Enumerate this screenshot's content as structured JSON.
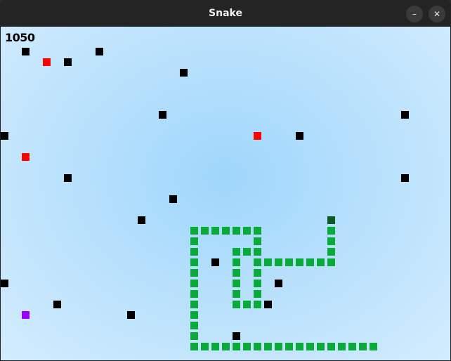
{
  "window": {
    "title": "Snake",
    "minimize_label": "–",
    "close_label": "✕"
  },
  "game": {
    "score": "1050",
    "grid_cell": 15,
    "colors": {
      "obstacle": "#000000",
      "food": "#ff0000",
      "special_food": "#9b00ff",
      "snake_body": "#0aaa3a",
      "snake_head": "#0a5a25"
    },
    "obstacles": [
      [
        2,
        2
      ],
      [
        9,
        2
      ],
      [
        6,
        3
      ],
      [
        17,
        4
      ],
      [
        15,
        8
      ],
      [
        38,
        8
      ],
      [
        0,
        10
      ],
      [
        28,
        10
      ],
      [
        6,
        14
      ],
      [
        38,
        14
      ],
      [
        16,
        16
      ],
      [
        13,
        18
      ],
      [
        20,
        22
      ],
      [
        0,
        24
      ],
      [
        26,
        24
      ],
      [
        5,
        26
      ],
      [
        25,
        26
      ],
      [
        12,
        27
      ],
      [
        22,
        29
      ]
    ],
    "food": [
      [
        4,
        3
      ],
      [
        24,
        10
      ],
      [
        2,
        12
      ]
    ],
    "special_food": [
      [
        2,
        27
      ]
    ],
    "snake_head": [
      31,
      18
    ],
    "snake_body": [
      [
        31,
        19
      ],
      [
        31,
        20
      ],
      [
        31,
        21
      ],
      [
        31,
        22
      ],
      [
        30,
        22
      ],
      [
        29,
        22
      ],
      [
        28,
        22
      ],
      [
        27,
        22
      ],
      [
        26,
        22
      ],
      [
        25,
        22
      ],
      [
        24,
        22
      ],
      [
        24,
        21
      ],
      [
        24,
        20
      ],
      [
        24,
        19
      ],
      [
        23,
        19
      ],
      [
        22,
        19
      ],
      [
        21,
        19
      ],
      [
        20,
        19
      ],
      [
        19,
        19
      ],
      [
        18,
        19
      ],
      [
        18,
        20
      ],
      [
        18,
        21
      ],
      [
        18,
        22
      ],
      [
        18,
        23
      ],
      [
        18,
        24
      ],
      [
        18,
        25
      ],
      [
        18,
        26
      ],
      [
        18,
        27
      ],
      [
        18,
        28
      ],
      [
        18,
        29
      ],
      [
        18,
        30
      ],
      [
        19,
        30
      ],
      [
        20,
        30
      ],
      [
        21,
        30
      ],
      [
        22,
        30
      ],
      [
        23,
        30
      ],
      [
        24,
        30
      ],
      [
        25,
        30
      ],
      [
        26,
        30
      ],
      [
        27,
        30
      ],
      [
        28,
        30
      ],
      [
        29,
        30
      ],
      [
        30,
        30
      ],
      [
        31,
        30
      ],
      [
        32,
        30
      ],
      [
        33,
        30
      ],
      [
        34,
        30
      ],
      [
        35,
        30
      ],
      [
        22,
        21
      ],
      [
        22,
        22
      ],
      [
        22,
        23
      ],
      [
        22,
        24
      ],
      [
        22,
        25
      ],
      [
        22,
        26
      ],
      [
        23,
        26
      ],
      [
        24,
        26
      ],
      [
        24,
        25
      ],
      [
        24,
        24
      ],
      [
        24,
        23
      ],
      [
        23,
        21
      ]
    ]
  }
}
